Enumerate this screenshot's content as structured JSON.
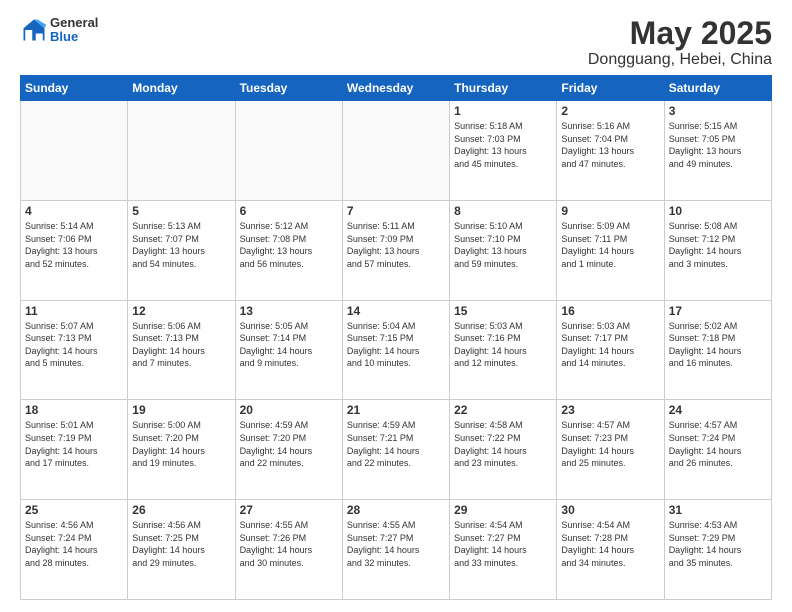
{
  "header": {
    "logo_general": "General",
    "logo_blue": "Blue",
    "month": "May 2025",
    "location": "Dongguang, Hebei, China"
  },
  "weekdays": [
    "Sunday",
    "Monday",
    "Tuesday",
    "Wednesday",
    "Thursday",
    "Friday",
    "Saturday"
  ],
  "weeks": [
    [
      {
        "day": "",
        "info": ""
      },
      {
        "day": "",
        "info": ""
      },
      {
        "day": "",
        "info": ""
      },
      {
        "day": "",
        "info": ""
      },
      {
        "day": "1",
        "info": "Sunrise: 5:18 AM\nSunset: 7:03 PM\nDaylight: 13 hours\nand 45 minutes."
      },
      {
        "day": "2",
        "info": "Sunrise: 5:16 AM\nSunset: 7:04 PM\nDaylight: 13 hours\nand 47 minutes."
      },
      {
        "day": "3",
        "info": "Sunrise: 5:15 AM\nSunset: 7:05 PM\nDaylight: 13 hours\nand 49 minutes."
      }
    ],
    [
      {
        "day": "4",
        "info": "Sunrise: 5:14 AM\nSunset: 7:06 PM\nDaylight: 13 hours\nand 52 minutes."
      },
      {
        "day": "5",
        "info": "Sunrise: 5:13 AM\nSunset: 7:07 PM\nDaylight: 13 hours\nand 54 minutes."
      },
      {
        "day": "6",
        "info": "Sunrise: 5:12 AM\nSunset: 7:08 PM\nDaylight: 13 hours\nand 56 minutes."
      },
      {
        "day": "7",
        "info": "Sunrise: 5:11 AM\nSunset: 7:09 PM\nDaylight: 13 hours\nand 57 minutes."
      },
      {
        "day": "8",
        "info": "Sunrise: 5:10 AM\nSunset: 7:10 PM\nDaylight: 13 hours\nand 59 minutes."
      },
      {
        "day": "9",
        "info": "Sunrise: 5:09 AM\nSunset: 7:11 PM\nDaylight: 14 hours\nand 1 minute."
      },
      {
        "day": "10",
        "info": "Sunrise: 5:08 AM\nSunset: 7:12 PM\nDaylight: 14 hours\nand 3 minutes."
      }
    ],
    [
      {
        "day": "11",
        "info": "Sunrise: 5:07 AM\nSunset: 7:13 PM\nDaylight: 14 hours\nand 5 minutes."
      },
      {
        "day": "12",
        "info": "Sunrise: 5:06 AM\nSunset: 7:13 PM\nDaylight: 14 hours\nand 7 minutes."
      },
      {
        "day": "13",
        "info": "Sunrise: 5:05 AM\nSunset: 7:14 PM\nDaylight: 14 hours\nand 9 minutes."
      },
      {
        "day": "14",
        "info": "Sunrise: 5:04 AM\nSunset: 7:15 PM\nDaylight: 14 hours\nand 10 minutes."
      },
      {
        "day": "15",
        "info": "Sunrise: 5:03 AM\nSunset: 7:16 PM\nDaylight: 14 hours\nand 12 minutes."
      },
      {
        "day": "16",
        "info": "Sunrise: 5:03 AM\nSunset: 7:17 PM\nDaylight: 14 hours\nand 14 minutes."
      },
      {
        "day": "17",
        "info": "Sunrise: 5:02 AM\nSunset: 7:18 PM\nDaylight: 14 hours\nand 16 minutes."
      }
    ],
    [
      {
        "day": "18",
        "info": "Sunrise: 5:01 AM\nSunset: 7:19 PM\nDaylight: 14 hours\nand 17 minutes."
      },
      {
        "day": "19",
        "info": "Sunrise: 5:00 AM\nSunset: 7:20 PM\nDaylight: 14 hours\nand 19 minutes."
      },
      {
        "day": "20",
        "info": "Sunrise: 4:59 AM\nSunset: 7:20 PM\nDaylight: 14 hours\nand 22 minutes."
      },
      {
        "day": "21",
        "info": "Sunrise: 4:59 AM\nSunset: 7:21 PM\nDaylight: 14 hours\nand 22 minutes."
      },
      {
        "day": "22",
        "info": "Sunrise: 4:58 AM\nSunset: 7:22 PM\nDaylight: 14 hours\nand 23 minutes."
      },
      {
        "day": "23",
        "info": "Sunrise: 4:57 AM\nSunset: 7:23 PM\nDaylight: 14 hours\nand 25 minutes."
      },
      {
        "day": "24",
        "info": "Sunrise: 4:57 AM\nSunset: 7:24 PM\nDaylight: 14 hours\nand 26 minutes."
      }
    ],
    [
      {
        "day": "25",
        "info": "Sunrise: 4:56 AM\nSunset: 7:24 PM\nDaylight: 14 hours\nand 28 minutes."
      },
      {
        "day": "26",
        "info": "Sunrise: 4:56 AM\nSunset: 7:25 PM\nDaylight: 14 hours\nand 29 minutes."
      },
      {
        "day": "27",
        "info": "Sunrise: 4:55 AM\nSunset: 7:26 PM\nDaylight: 14 hours\nand 30 minutes."
      },
      {
        "day": "28",
        "info": "Sunrise: 4:55 AM\nSunset: 7:27 PM\nDaylight: 14 hours\nand 32 minutes."
      },
      {
        "day": "29",
        "info": "Sunrise: 4:54 AM\nSunset: 7:27 PM\nDaylight: 14 hours\nand 33 minutes."
      },
      {
        "day": "30",
        "info": "Sunrise: 4:54 AM\nSunset: 7:28 PM\nDaylight: 14 hours\nand 34 minutes."
      },
      {
        "day": "31",
        "info": "Sunrise: 4:53 AM\nSunset: 7:29 PM\nDaylight: 14 hours\nand 35 minutes."
      }
    ]
  ]
}
